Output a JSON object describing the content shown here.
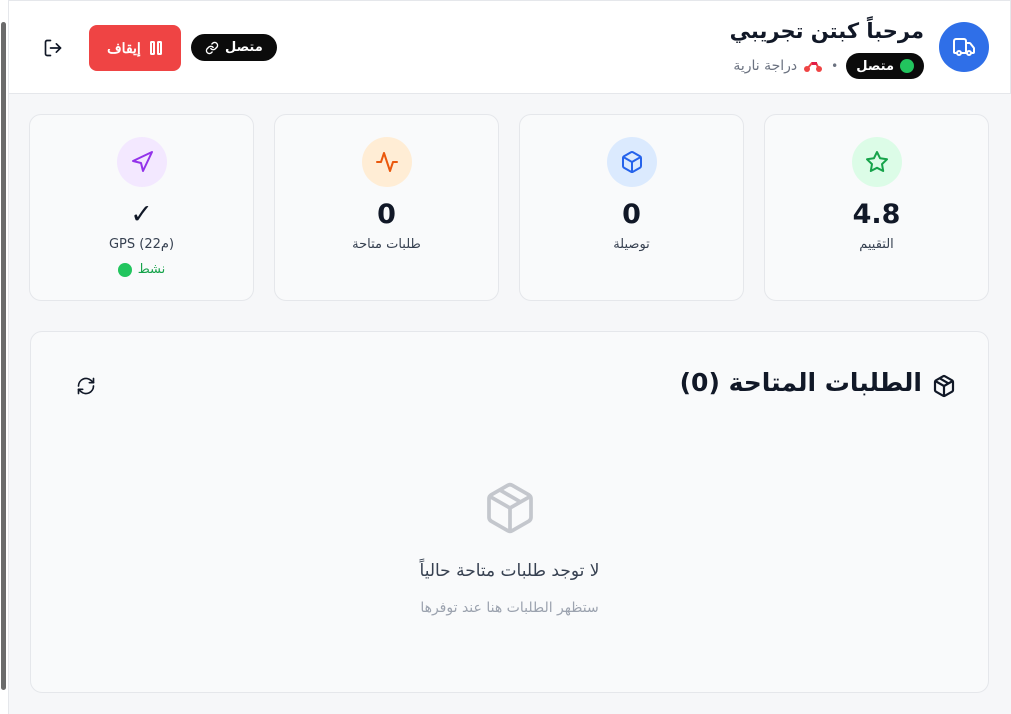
{
  "header": {
    "greeting": "مرحباً كبتن تجريبي",
    "status": "متصل",
    "vehicle_type": "دراجة نارية",
    "separator": "•",
    "connection_label": "متصل",
    "stop_label": "إيقاف"
  },
  "stats": [
    {
      "value": "4.8",
      "label": "التقييم",
      "icon": "star-icon",
      "color": "#16a34a",
      "bg": "#dcfce7"
    },
    {
      "value": "0",
      "label": "توصيلة",
      "icon": "package-icon",
      "color": "#2563eb",
      "bg": "#dbeafe"
    },
    {
      "value": "0",
      "label": "طلبات متاحة",
      "icon": "activity-icon",
      "color": "#ea580c",
      "bg": "#ffedd5"
    },
    {
      "value": "✓",
      "label": "GPS (22م)",
      "status": "نشط",
      "icon": "navigation-icon",
      "color": "#9333ea",
      "bg": "#f3e8ff"
    }
  ],
  "orders": {
    "title": "الطلبات المتاحة (0)",
    "empty_title": "لا توجد طلبات متاحة حالياً",
    "empty_subtitle": "ستظهر الطلبات هنا عند توفرها"
  },
  "colors": {
    "brand_blue": "#2f6fe8",
    "danger": "#ef4444",
    "online_green": "#22c55e"
  }
}
